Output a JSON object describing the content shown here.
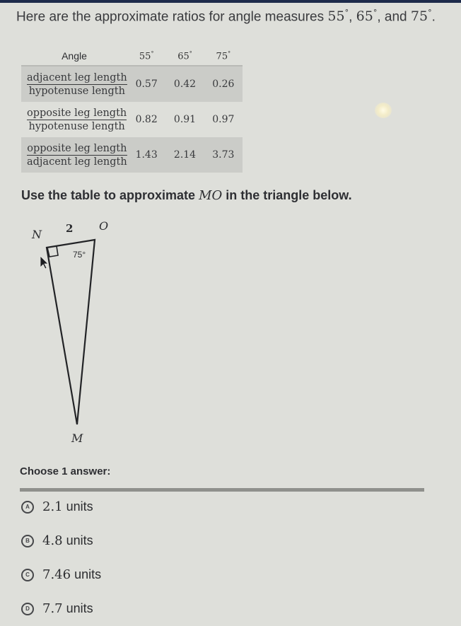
{
  "intro": {
    "prefix": "Here are the approximate ratios for angle measures",
    "angles": [
      "55",
      "65",
      "75"
    ],
    "degree_symbol": "°",
    "sep1": ",",
    "sep2": ", and",
    "end": "."
  },
  "table": {
    "header": {
      "angle_label": "Angle",
      "angles": [
        "55",
        "65",
        "75"
      ],
      "degree_symbol": "°"
    },
    "rows": [
      {
        "numerator": "adjacent leg length",
        "denominator": "hypotenuse length",
        "values": [
          "0.57",
          "0.42",
          "0.26"
        ]
      },
      {
        "numerator": "opposite leg length",
        "denominator": "hypotenuse length",
        "values": [
          "0.82",
          "0.91",
          "0.97"
        ]
      },
      {
        "numerator": "opposite leg length",
        "denominator": "adjacent leg length",
        "values": [
          "1.43",
          "2.14",
          "3.73"
        ]
      }
    ]
  },
  "prompt": {
    "before": "Use the table to approximate",
    "segment": "MO",
    "after": "in the triangle below."
  },
  "triangle": {
    "vertices": {
      "n": "N",
      "o": "O",
      "m": "M"
    },
    "side_no": "2",
    "angle_o": "75°"
  },
  "question": {
    "choose_label": "Choose 1 answer:",
    "options": [
      {
        "letter": "A",
        "value": "2.1",
        "unit": "units"
      },
      {
        "letter": "B",
        "value": "4.8",
        "unit": "units"
      },
      {
        "letter": "C",
        "value": "7.46",
        "unit": "units"
      },
      {
        "letter": "D",
        "value": "7.7",
        "unit": "units"
      }
    ]
  },
  "colors": {
    "background": "#dedfda",
    "top_bar": "#1d2a4a",
    "table_shade": "#cbccc8",
    "divider": "#8f908c"
  }
}
